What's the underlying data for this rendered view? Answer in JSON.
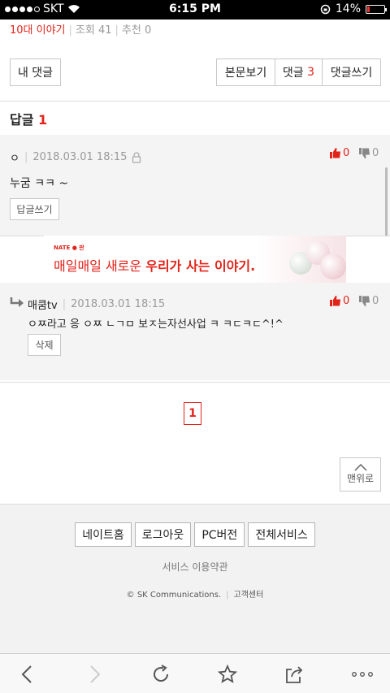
{
  "status_bar": {
    "carrier": "SKT",
    "time": "6:15 PM",
    "battery": "14%",
    "battery_level": 0.14
  },
  "topline": {
    "title": "10대 이야기",
    "views": "조회 41",
    "recommend": "추천 0"
  },
  "buttons": {
    "my_comments": "내 댓글",
    "view_body": "본문보기",
    "comments_label": "댓글",
    "comments_count": "3",
    "write_comment": "댓글쓰기"
  },
  "reply_header": {
    "label": "답글",
    "count": "1"
  },
  "comment1": {
    "author": "ㅇ",
    "date": "2018.03.01 18:15",
    "text": "누굼 ㅋㅋ ~",
    "likes": "0",
    "dislikes": "0",
    "reply_button": "답글쓰기"
  },
  "banner": {
    "brand": "NATE ● 판",
    "text_plain": "매일매일 새로운",
    "text_bold": "우리가 사는 이야기."
  },
  "comment2": {
    "author": "매쿰tv",
    "date": "2018.03.01 18:15",
    "text": "ㅇㅉ라고 응 ㅇㅉ ㄴㄱㅁ 보ㅈ는자선사업 ㅋ ㅋㄷㅋㄷ^!^",
    "likes": "0",
    "dislikes": "0",
    "delete_button": "삭제"
  },
  "pagination": {
    "current": "1"
  },
  "to_top": "맨위로",
  "footer": {
    "buttons": [
      "네이트홈",
      "로그아웃",
      "PC버전",
      "전체서비스"
    ],
    "terms": "서비스 이용약관",
    "copyright": "© SK Communications.",
    "support": "고객센터"
  },
  "colors": {
    "accent": "#e2231a",
    "grey_bg": "#f4f4f4"
  }
}
